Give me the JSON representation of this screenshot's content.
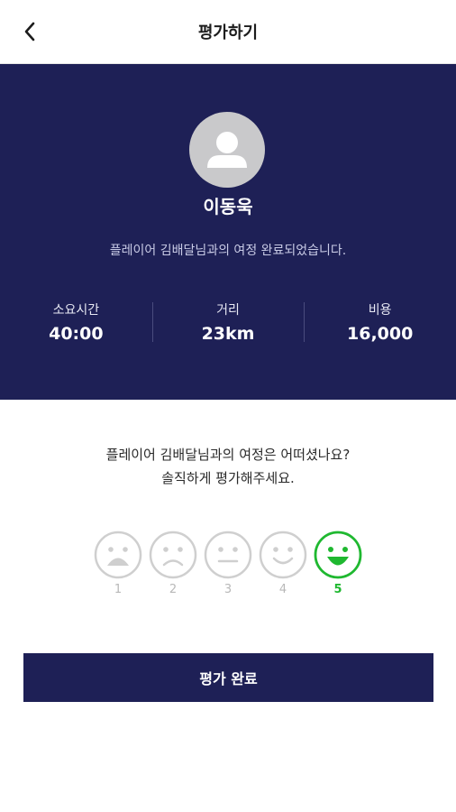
{
  "header": {
    "title": "평가하기",
    "back_icon": "chevron-left-icon"
  },
  "profile": {
    "avatar_icon": "user-avatar-icon",
    "name": "이동욱"
  },
  "summary": {
    "message": "플레이어 김배달님과의 여정 완료되었습니다."
  },
  "stats": [
    {
      "label": "소요시간",
      "value": "40:00"
    },
    {
      "label": "거리",
      "value": "23km"
    },
    {
      "label": "비용",
      "value": "16,000"
    }
  ],
  "question": {
    "line1": "플레이어 김배달님과의 여정은 어떠셨나요?",
    "line2": "솔직하게 평가해주세요."
  },
  "ratings": {
    "selected": 5,
    "items": [
      {
        "label": "1",
        "icon": "very-sad-face-icon"
      },
      {
        "label": "2",
        "icon": "sad-face-icon"
      },
      {
        "label": "3",
        "icon": "neutral-face-icon"
      },
      {
        "label": "4",
        "icon": "smile-face-icon"
      },
      {
        "label": "5",
        "icon": "big-smile-face-icon"
      }
    ]
  },
  "submit": {
    "label": "평가 완료"
  },
  "colors": {
    "navy": "#1e2056",
    "selected_green": "#1fb830",
    "inactive_gray": "#cfcfcf"
  }
}
